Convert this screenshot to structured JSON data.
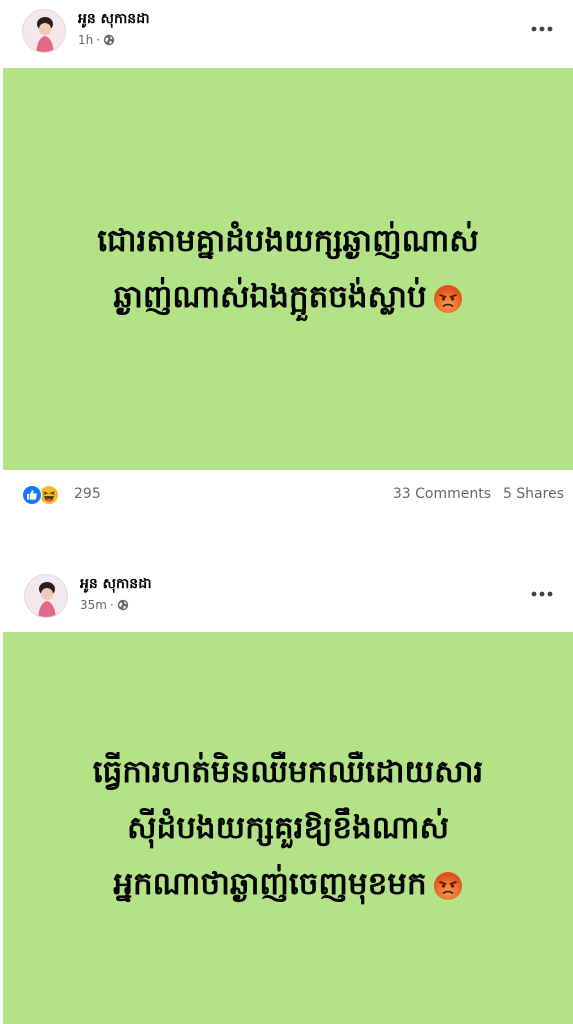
{
  "posts": [
    {
      "author": "អូន សុកានដា",
      "time": "1h",
      "text_lines": [
        "ជោរតាមគ្នាដំបងយក្សឆ្ងាញ់ណាស់",
        "ឆ្ងាញ់ណាស់ឯងក្អួតចង់ស្លាប់"
      ],
      "icons": {
        "time_icon": "globe-icon",
        "emoji": "angry-face-icon",
        "more": "more-options-icon"
      },
      "stats": {
        "reaction_icons": [
          "like-icon",
          "haha-icon"
        ],
        "reaction_count": "295",
        "comments": "33 Comments",
        "shares": "5 Shares"
      },
      "card_color": "#b3e386"
    },
    {
      "author": "អូន សុកានដា",
      "time": "35m",
      "text_lines": [
        "ធ្វើការហត់មិនឈឺមកឈឺដោយសារ",
        "ស៊ីដំបងយក្សគួរឱ្យខឹងណាស់",
        "អ្នកណាថាឆ្ងាញ់ចេញមុខមក"
      ],
      "icons": {
        "time_icon": "globe-icon",
        "emoji": "angry-face-icon",
        "more": "more-options-icon"
      },
      "card_color": "#b3e386"
    }
  ],
  "colors": {
    "like_blue": "#1877f2",
    "haha_yellow": "#f7b928",
    "angry_orange": "#e9710f",
    "meta_gray": "#65676b"
  }
}
